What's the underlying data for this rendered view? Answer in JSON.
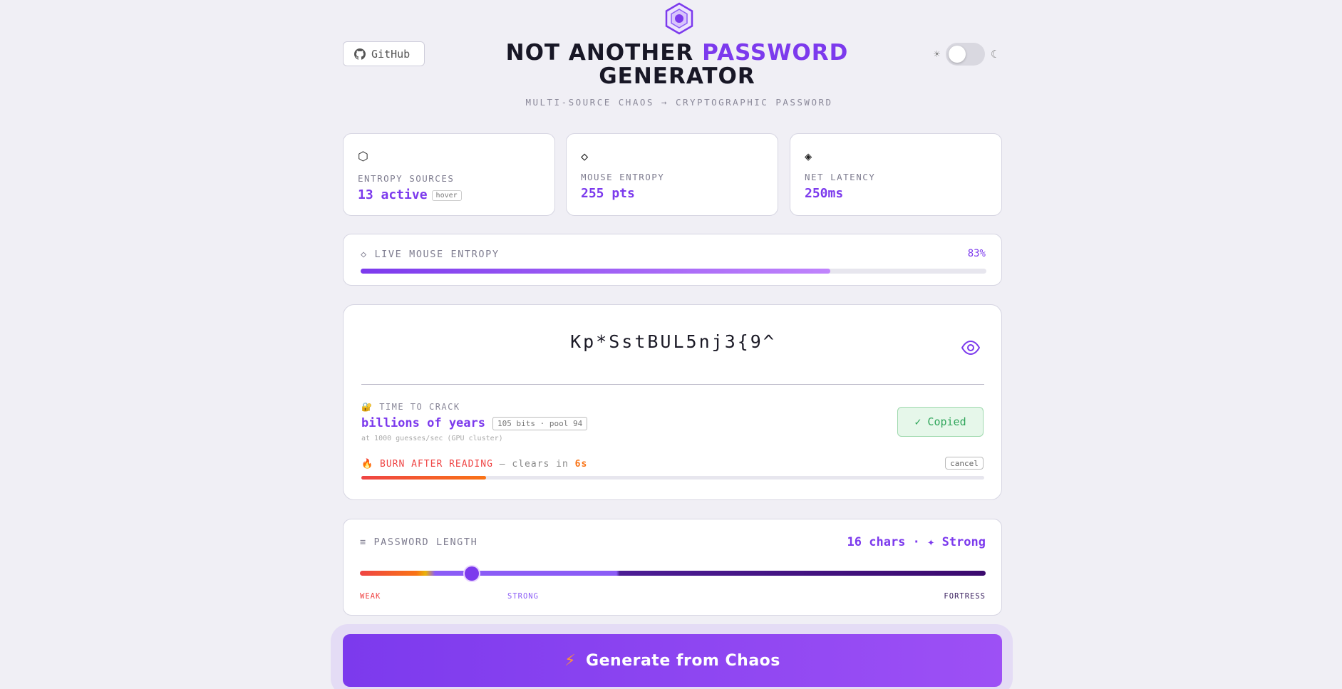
{
  "header": {
    "logo_icon": "hexagon-logo-icon",
    "github_label": "GitHub",
    "title_part1": "NOT ANOTHER",
    "title_accent": "PASSWORD",
    "title_part2": "GENERATOR",
    "subtitle": "MULTI-SOURCE CHAOS → CRYPTOGRAPHIC PASSWORD",
    "theme": {
      "light_icon": "☀",
      "dark_icon": "☾",
      "dark_mode": false
    }
  },
  "stats": [
    {
      "icon": "⬡",
      "label": "ENTROPY SOURCES",
      "value": "13 active",
      "badge": "hover"
    },
    {
      "icon": "◇",
      "label": "MOUSE ENTROPY",
      "value": "255 pts"
    },
    {
      "icon": "◈",
      "label": "NET LATENCY",
      "value": "250ms"
    }
  ],
  "live_entropy": {
    "label": "◇ LIVE MOUSE ENTROPY",
    "percent_label": "83%",
    "progress": 0.75
  },
  "password": {
    "value": "Kp*SstBUL5nj3{9^",
    "crack_label": "TIME TO CRACK",
    "crack_value": "billions of years",
    "crack_badge": "105 bits · pool 94",
    "crack_note": "at 1000 guesses/sec (GPU cluster)",
    "copied_label": "✓ Copied",
    "burn_label": "BURN AFTER READING",
    "burn_mid": "— clears in",
    "burn_seconds": "6s",
    "burn_progress": 0.2,
    "cancel_label": "cancel"
  },
  "length": {
    "label": "≡ PASSWORD LENGTH",
    "summary": "16 chars · ✦ Strong",
    "value": 16,
    "scale_weak": "WEAK",
    "scale_strong": "STRONG",
    "scale_fortress": "FORTRESS"
  },
  "generate": {
    "label": "Generate from Chaos",
    "icon": "⚡"
  },
  "colors": {
    "accent": "#7c3aed",
    "copied": "#2fa55a",
    "burn": "#ef4444",
    "burn_time": "#f97316"
  }
}
